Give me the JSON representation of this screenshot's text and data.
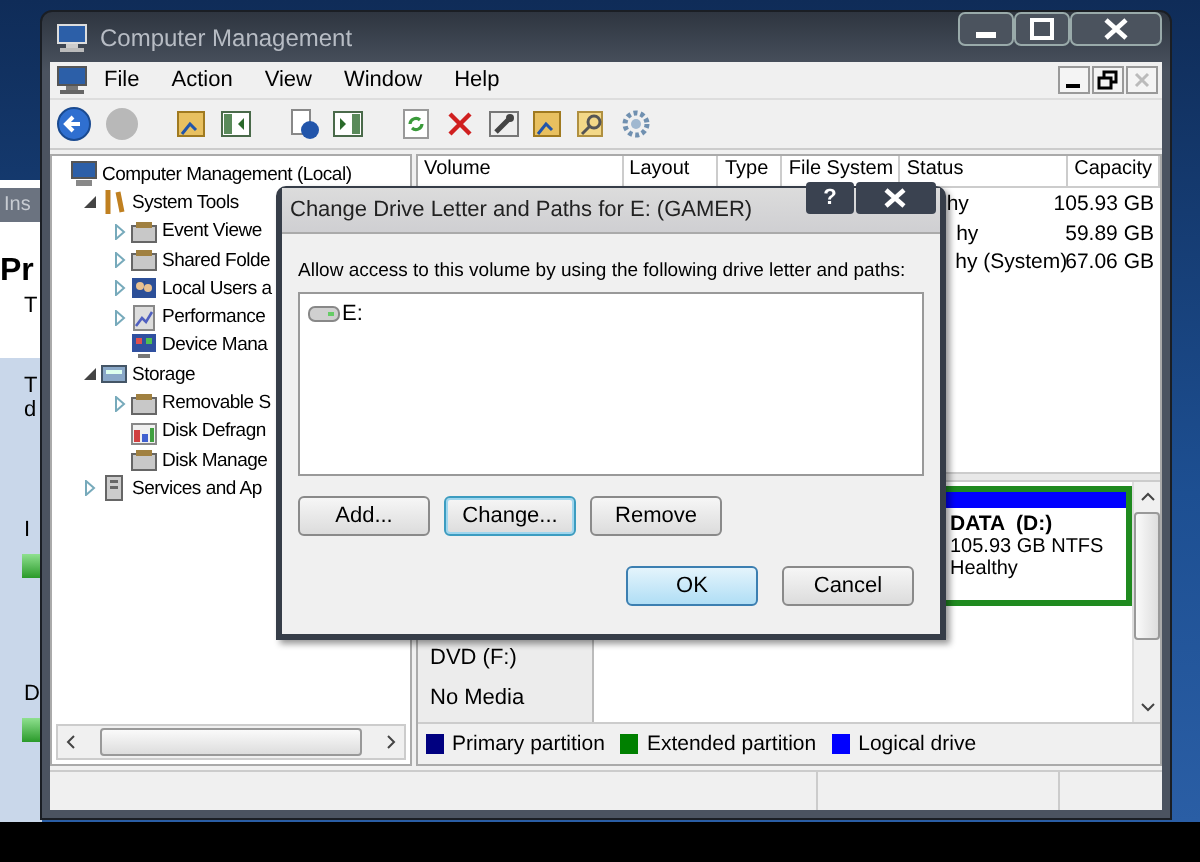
{
  "background_window": {
    "tab": "Ins",
    "heading": "Pr",
    "texts": [
      "T",
      "T",
      "d",
      "I",
      "D"
    ]
  },
  "window": {
    "title": "Computer Management"
  },
  "menu": [
    "File",
    "Action",
    "View",
    "Window",
    "Help"
  ],
  "tree": [
    {
      "label": "Computer Management (Local)",
      "has_children": false,
      "children": [
        {
          "label": "System Tools",
          "has_children": true,
          "expanded": true,
          "children": [
            {
              "label": "Event Viewe",
              "has_children": true,
              "expanded": false
            },
            {
              "label": "Shared Folde",
              "has_children": true,
              "expanded": false
            },
            {
              "label": "Local Users a",
              "has_children": true,
              "expanded": false
            },
            {
              "label": "Performance",
              "has_children": true,
              "expanded": false
            },
            {
              "label": "Device Mana",
              "has_children": false
            }
          ]
        },
        {
          "label": "Storage",
          "has_children": true,
          "expanded": true,
          "children": [
            {
              "label": "Removable S",
              "has_children": true,
              "expanded": false
            },
            {
              "label": "Disk Defragn",
              "has_children": false
            },
            {
              "label": "Disk Manage",
              "has_children": false
            }
          ]
        },
        {
          "label": "Services and Ap",
          "has_children": true,
          "expanded": false
        }
      ]
    }
  ],
  "volume_table": {
    "columns": [
      "Volume",
      "Layout",
      "Type",
      "File System",
      "Status",
      "Capacity"
    ],
    "rows": [
      {
        "status": "hy",
        "capacity": "105.93 GB"
      },
      {
        "status": "hy",
        "capacity": "59.89 GB"
      },
      {
        "status": "hy (System)",
        "capacity": "67.06 GB"
      }
    ]
  },
  "partitions": [
    {
      "name": "DATA  (D:)",
      "detail": "105.93 GB NTFS",
      "status": "Healthy",
      "color": "#0000ff"
    }
  ],
  "drives": [
    {
      "name": "DVD (F:)",
      "status": "No Media"
    }
  ],
  "legend": [
    {
      "label": "Primary partition",
      "color": "#000080"
    },
    {
      "label": "Extended partition",
      "color": "#008000"
    },
    {
      "label": "Logical drive",
      "color": "#0000ff"
    }
  ],
  "dialog": {
    "title": "Change Drive Letter and Paths for E: (GAMER)",
    "help": "?",
    "prompt": "Allow access to this volume by using the following drive letter and paths:",
    "paths": [
      {
        "label": "E:",
        "selected": false
      }
    ],
    "buttons": [
      {
        "label": "Add...",
        "focused": false,
        "default": false
      },
      {
        "label": "Change...",
        "focused": true,
        "default": false
      },
      {
        "label": "Remove",
        "focused": false,
        "default": false
      }
    ],
    "confirm_buttons": [
      {
        "label": "OK",
        "focused": false,
        "default": true
      },
      {
        "label": "Cancel",
        "focused": false,
        "default": false
      }
    ]
  }
}
